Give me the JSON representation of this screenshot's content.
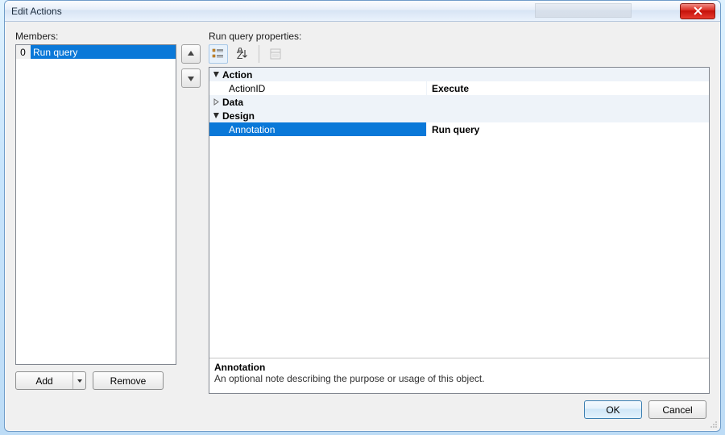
{
  "window": {
    "title": "Edit Actions"
  },
  "left": {
    "members_label": "Members:",
    "items": [
      {
        "index": "0",
        "text": "Run query"
      }
    ],
    "add_label": "Add",
    "remove_label": "Remove"
  },
  "right": {
    "props_label": "Run query properties:",
    "categories": [
      {
        "name": "Action",
        "expanded": true,
        "rows": [
          {
            "name": "ActionID",
            "value": "Execute",
            "bold": true
          }
        ]
      },
      {
        "name": "Data",
        "expanded": false,
        "rows": []
      },
      {
        "name": "Design",
        "expanded": true,
        "rows": [
          {
            "name": "Annotation",
            "value": "Run query",
            "bold": true,
            "selected": true
          }
        ]
      }
    ],
    "desc": {
      "name": "Annotation",
      "text": "An optional note describing the purpose or usage of this object."
    }
  },
  "footer": {
    "ok_label": "OK",
    "cancel_label": "Cancel"
  }
}
